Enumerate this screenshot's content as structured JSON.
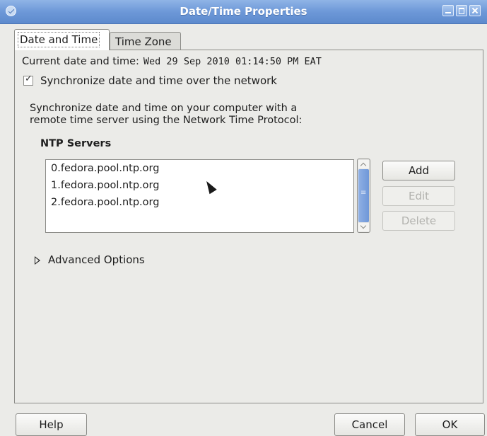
{
  "window": {
    "title": "Date/Time Properties"
  },
  "tabs": [
    {
      "label": "Date and Time",
      "active": true
    },
    {
      "label": "Time Zone",
      "active": false
    }
  ],
  "datetime": {
    "current_label": "Current date and time:",
    "current_value": "Wed 29 Sep 2010 01:14:50 PM EAT"
  },
  "sync": {
    "label": "Synchronize date and time over the network",
    "checked": true,
    "description_line1": "Synchronize date and time on your computer with a",
    "description_line2": "remote time server using the Network Time Protocol:"
  },
  "ntp": {
    "heading": "NTP Servers",
    "servers": [
      "0.fedora.pool.ntp.org",
      "1.fedora.pool.ntp.org",
      "2.fedora.pool.ntp.org"
    ],
    "add_label": "Add",
    "edit_label": "Edit",
    "delete_label": "Delete"
  },
  "advanced": {
    "label": "Advanced Options"
  },
  "footer": {
    "help_label": "Help",
    "cancel_label": "Cancel",
    "ok_label": "OK"
  },
  "colors": {
    "titlebar": "#6d98d8",
    "dialog_bg": "#ebebe8",
    "scroll_thumb": "#7aa3de"
  }
}
